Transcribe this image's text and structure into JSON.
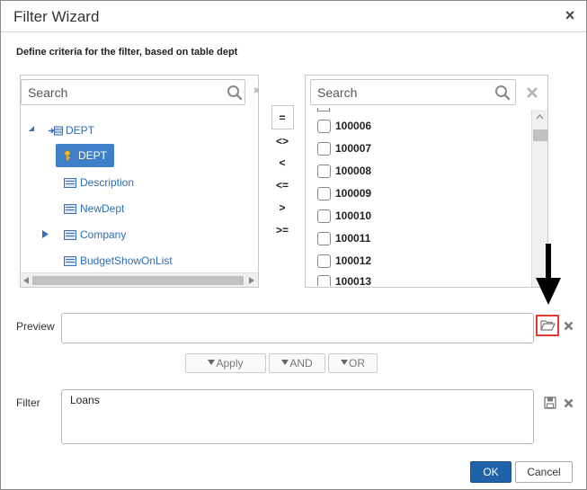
{
  "dialog": {
    "title": "Filter Wizard",
    "close_label": "×",
    "subtitle": "Define criteria for the filter, based on table dept"
  },
  "left_search": {
    "placeholder": "Search"
  },
  "tree": {
    "root": "DEPT",
    "selected": "DEPT",
    "nodes": [
      "Description",
      "NewDept",
      "Company",
      "BudgetShowOnList"
    ]
  },
  "operators": [
    "=",
    "<>",
    "<",
    "<=",
    ">",
    ">="
  ],
  "right_search": {
    "placeholder": "Search"
  },
  "values": [
    "100006",
    "100007",
    "100008",
    "100009",
    "100010",
    "100011",
    "100012",
    "100013"
  ],
  "preview": {
    "label": "Preview",
    "value": ""
  },
  "actions": {
    "apply": "Apply",
    "and": "AND",
    "or": "OR"
  },
  "filter": {
    "label": "Filter",
    "value": "Loans"
  },
  "footer": {
    "ok": "OK",
    "cancel": "Cancel"
  },
  "colors": {
    "accent": "#1f62a8",
    "link": "#2a6db5",
    "highlight": "#e53935"
  }
}
